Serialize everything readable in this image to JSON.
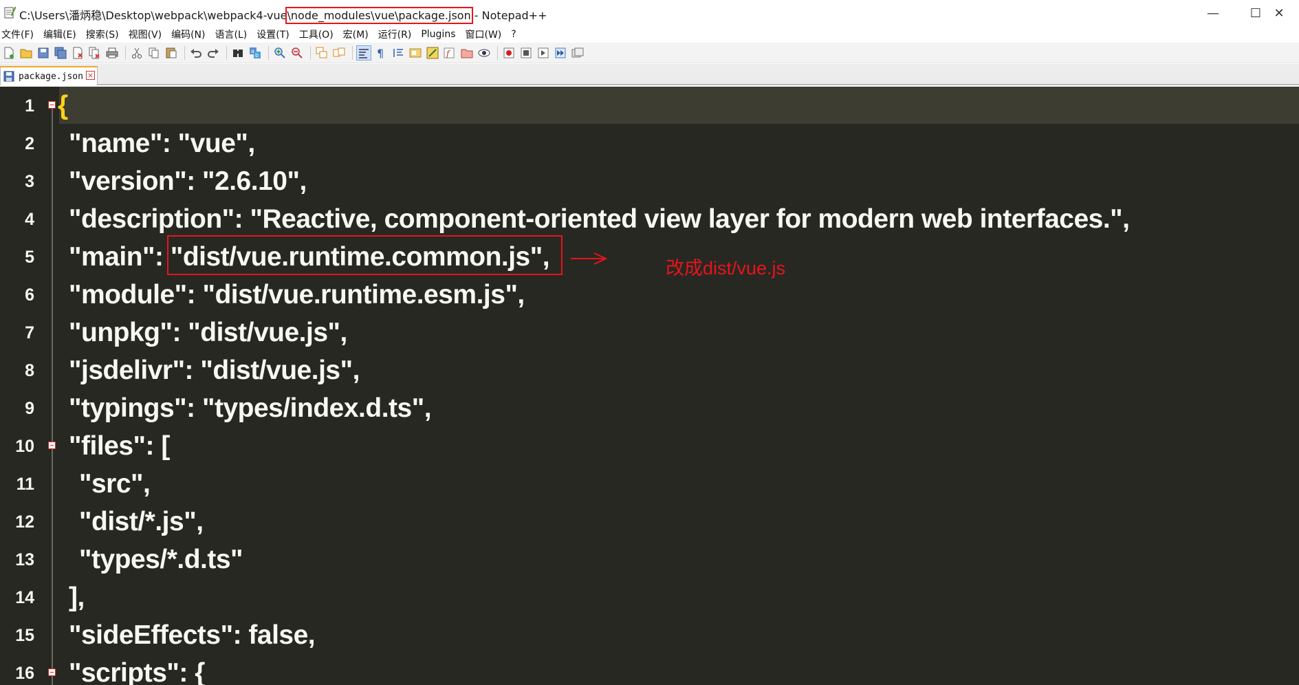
{
  "window": {
    "title_prefix": "C:\\Users\\潘炳稳\\Desktop\\webpack\\webpack4-vue",
    "title_highlight": "\\node_modules\\vue\\package.json",
    "title_suffix": " - Notepad++",
    "minimize": "—",
    "maximize": "☐",
    "close": "✕"
  },
  "menu": [
    "文件(F)",
    "编辑(E)",
    "搜索(S)",
    "视图(V)",
    "编码(N)",
    "语言(L)",
    "设置(T)",
    "工具(O)",
    "宏(M)",
    "运行(R)",
    "Plugins",
    "窗口(W)",
    "?"
  ],
  "toolbar": {
    "icons": [
      "new-file-icon",
      "open-file-icon",
      "save-icon",
      "save-all-icon",
      "close-icon",
      "close-all-icon",
      "print-icon",
      "cut-icon",
      "copy-icon",
      "paste-icon",
      "undo-icon",
      "redo-icon",
      "find-icon",
      "replace-icon",
      "zoom-in-icon",
      "zoom-out-icon",
      "sync-vertical-icon",
      "sync-horizontal-icon",
      "word-wrap-icon",
      "show-all-chars-icon",
      "indent-guide-icon",
      "doc-map-icon",
      "function-list-icon",
      "folder-workspace-icon",
      "monitor-icon",
      "record-macro-icon",
      "stop-macro-icon",
      "play-macro-icon",
      "run-macro-multiple-icon",
      "save-macro-icon"
    ]
  },
  "tab": {
    "label": "package.json",
    "close": "×"
  },
  "colors": {
    "editor_bg": "#272822",
    "text": "#f8f8f2",
    "brace": "#ffd21a",
    "annotation": "#e8141c"
  },
  "editor": {
    "lines": [
      {
        "num": "1",
        "text": "{"
      },
      {
        "num": "2",
        "text": "\"name\": \"vue\","
      },
      {
        "num": "3",
        "text": "\"version\": \"2.6.10\","
      },
      {
        "num": "4",
        "text": "\"description\": \"Reactive, component-oriented view layer for modern web interfaces.\","
      },
      {
        "num": "5",
        "text": "\"main\": \"dist/vue.runtime.common.js\","
      },
      {
        "num": "6",
        "text": "\"module\": \"dist/vue.runtime.esm.js\","
      },
      {
        "num": "7",
        "text": "\"unpkg\": \"dist/vue.js\","
      },
      {
        "num": "8",
        "text": "\"jsdelivr\": \"dist/vue.js\","
      },
      {
        "num": "9",
        "text": "\"typings\": \"types/index.d.ts\","
      },
      {
        "num": "10",
        "text": "\"files\": ["
      },
      {
        "num": "11",
        "text": "\"src\","
      },
      {
        "num": "12",
        "text": "\"dist/*.js\","
      },
      {
        "num": "13",
        "text": "\"types/*.d.ts\""
      },
      {
        "num": "14",
        "text": "],"
      },
      {
        "num": "15",
        "text": "\"sideEffects\": false,"
      },
      {
        "num": "16",
        "text": "\"scripts\": {"
      }
    ]
  },
  "annotation": {
    "note": "改成dist/vue.js"
  }
}
